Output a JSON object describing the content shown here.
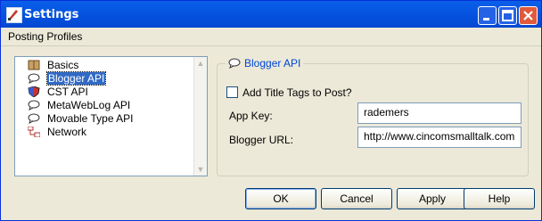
{
  "window": {
    "title": "Settings"
  },
  "menu": {
    "posting_profiles": "Posting Profiles"
  },
  "tree": {
    "items": [
      {
        "label": "Basics",
        "icon": "book-icon"
      },
      {
        "label": "Blogger API",
        "icon": "speech-bubble-icon",
        "selected": true
      },
      {
        "label": "CST API",
        "icon": "shield-icon"
      },
      {
        "label": "MetaWebLog API",
        "icon": "speech-bubble-icon"
      },
      {
        "label": "Movable Type API",
        "icon": "speech-bubble-icon"
      },
      {
        "label": "Network",
        "icon": "network-icon"
      }
    ]
  },
  "panel": {
    "title": "Blogger API",
    "add_title_tags": {
      "label": "Add Title Tags to Post?",
      "checked": false
    },
    "app_key": {
      "label": "App Key:",
      "value": "rademers"
    },
    "blogger_url": {
      "label": "Blogger URL:",
      "value": "http://www.cincomsmalltalk.com"
    }
  },
  "buttons": {
    "ok": "OK",
    "cancel": "Cancel",
    "apply": "Apply",
    "help": "Help"
  },
  "colors": {
    "titlebar": "#0553e0",
    "selection": "#316ac5",
    "legend": "#0046d5"
  }
}
